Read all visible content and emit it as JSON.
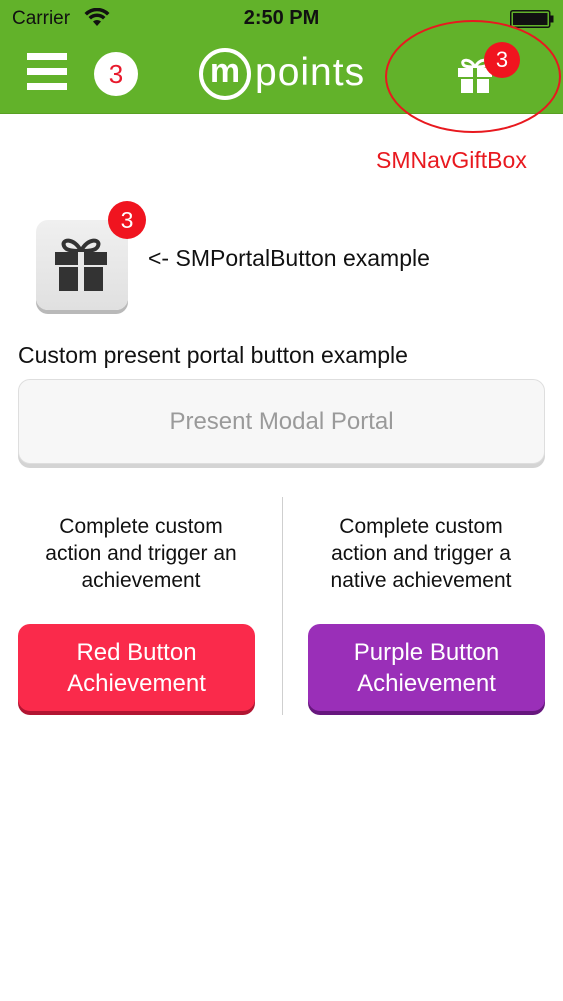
{
  "status_bar": {
    "carrier": "Carrier",
    "time": "2:50 PM"
  },
  "nav_bar": {
    "count_badge": "3",
    "logo_letter": "m",
    "logo_text": "points",
    "gift_badge": "3",
    "annotation": "SMNavGiftBox",
    "background_color": "#62b22a"
  },
  "portal": {
    "badge": "3",
    "caption": "<- SMPortalButton example"
  },
  "custom_portal": {
    "heading": "Custom present portal button example",
    "button_label": "Present Modal Portal"
  },
  "left_column": {
    "description": [
      "Complete custom",
      "action and trigger an",
      "achievement"
    ],
    "button_line1": "Red Button",
    "button_line2": "Achievement",
    "button_color": "#fa2a4b"
  },
  "right_column": {
    "description": [
      "Complete custom",
      "action and trigger a",
      "native achievement"
    ],
    "button_line1": "Purple Button",
    "button_line2": "Achievement",
    "button_color": "#9a2fb8"
  },
  "icons": [
    "wifi-icon",
    "battery-icon",
    "hamburger-icon",
    "gift-icon"
  ]
}
